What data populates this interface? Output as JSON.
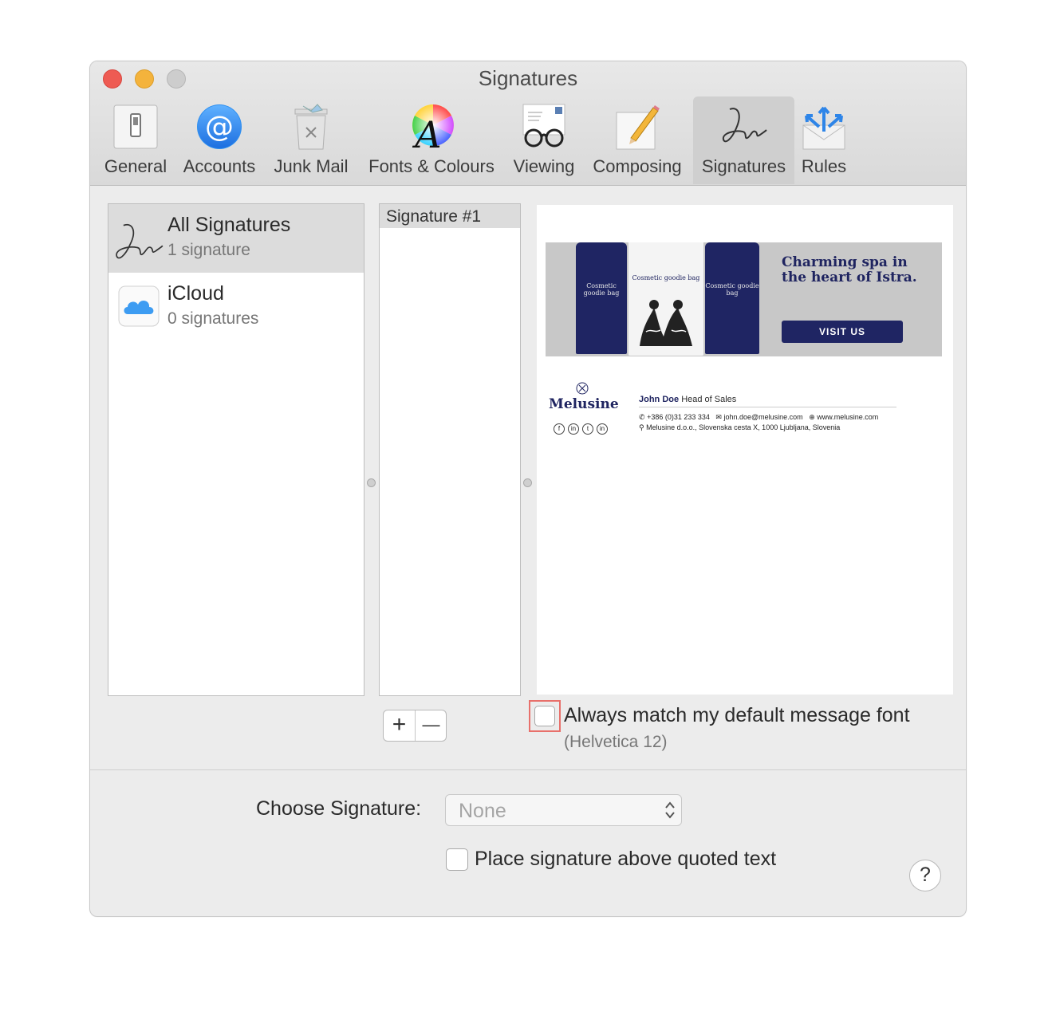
{
  "window": {
    "title": "Signatures"
  },
  "toolbar": {
    "items": [
      {
        "label": "General"
      },
      {
        "label": "Accounts"
      },
      {
        "label": "Junk Mail"
      },
      {
        "label": "Fonts & Colours"
      },
      {
        "label": "Viewing"
      },
      {
        "label": "Composing"
      },
      {
        "label": "Signatures",
        "active": true
      },
      {
        "label": "Rules"
      }
    ]
  },
  "accounts": [
    {
      "name": "All Signatures",
      "count": "1 signature",
      "selected": true,
      "icon": "signature-icon"
    },
    {
      "name": "iCloud",
      "count": "0 signatures",
      "selected": false,
      "icon": "icloud-icon"
    }
  ],
  "signatures": [
    {
      "name": "Signature #1",
      "selected": true
    }
  ],
  "preview": {
    "banner": {
      "bags": [
        "Cosmetic goodie bag",
        "Cosmetic goodie bag",
        "Cosmetic goodie bag"
      ],
      "headline": "Charming spa in the heart of Istra.",
      "button": "VISIT US"
    },
    "signature": {
      "brand": "Melusine",
      "name": "John Doe",
      "role": "Head of Sales",
      "phone": "+386 (0)31 233 334",
      "email": "john.doe@melusine.com",
      "web": "www.melusine.com",
      "address": "Melusine d.o.o., Slovenska cesta X, 1000 Ljubljana, Slovenia",
      "social": [
        "f",
        "in",
        "t",
        "in"
      ]
    }
  },
  "buttons": {
    "add": "+",
    "remove": "—"
  },
  "options": {
    "match_font_label": "Always match my default message font",
    "match_font_checked": false,
    "match_font_sub": "(Helvetica 12)",
    "choose_label": "Choose Signature:",
    "choose_value": "None",
    "place_above_label": "Place signature above quoted text",
    "place_above_checked": false
  },
  "help": "?",
  "colors": {
    "close": "#ee5b53",
    "minimize": "#f4b33c",
    "brand_navy": "#1f2460",
    "focus_ring": "#e8706b"
  }
}
